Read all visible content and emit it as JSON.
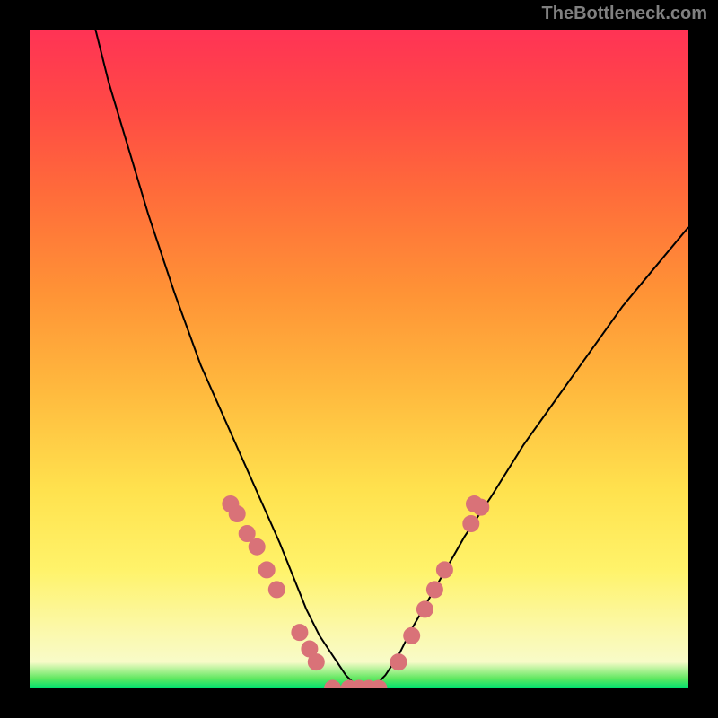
{
  "watermark": "TheBottleneck.com",
  "chart_data": {
    "type": "line",
    "title": "",
    "xlabel": "",
    "ylabel": "",
    "xlim": [
      0,
      100
    ],
    "ylim": [
      0,
      100
    ],
    "series": [
      {
        "name": "curve",
        "x": [
          10,
          12,
          15,
          18,
          22,
          26,
          30,
          34,
          38,
          42,
          44,
          46,
          48,
          50,
          52,
          54,
          56,
          58,
          62,
          66,
          70,
          75,
          80,
          85,
          90,
          95,
          100
        ],
        "y": [
          100,
          92,
          82,
          72,
          60,
          49,
          40,
          31,
          22,
          12,
          8,
          5,
          2,
          0,
          0,
          2,
          5,
          9,
          16,
          23,
          29,
          37,
          44,
          51,
          58,
          64,
          70
        ]
      }
    ],
    "markers": [
      {
        "x": 30.5,
        "y": 28.0
      },
      {
        "x": 31.5,
        "y": 26.5
      },
      {
        "x": 33.0,
        "y": 23.5
      },
      {
        "x": 34.5,
        "y": 21.5
      },
      {
        "x": 36.0,
        "y": 18.0
      },
      {
        "x": 37.5,
        "y": 15.0
      },
      {
        "x": 41.0,
        "y": 8.5
      },
      {
        "x": 42.5,
        "y": 6.0
      },
      {
        "x": 43.5,
        "y": 4.0
      },
      {
        "x": 46.0,
        "y": 0.0
      },
      {
        "x": 48.5,
        "y": 0.0
      },
      {
        "x": 50.0,
        "y": 0.0
      },
      {
        "x": 51.5,
        "y": 0.0
      },
      {
        "x": 53.0,
        "y": 0.0
      },
      {
        "x": 56.0,
        "y": 4.0
      },
      {
        "x": 58.0,
        "y": 8.0
      },
      {
        "x": 60.0,
        "y": 12.0
      },
      {
        "x": 61.5,
        "y": 15.0
      },
      {
        "x": 63.0,
        "y": 18.0
      },
      {
        "x": 67.0,
        "y": 25.0
      },
      {
        "x": 68.5,
        "y": 27.5
      },
      {
        "x": 67.5,
        "y": 28.0
      }
    ],
    "colors": {
      "curve": "#000000",
      "marker_fill": "#d97278",
      "marker_stroke": "#d97278"
    }
  }
}
